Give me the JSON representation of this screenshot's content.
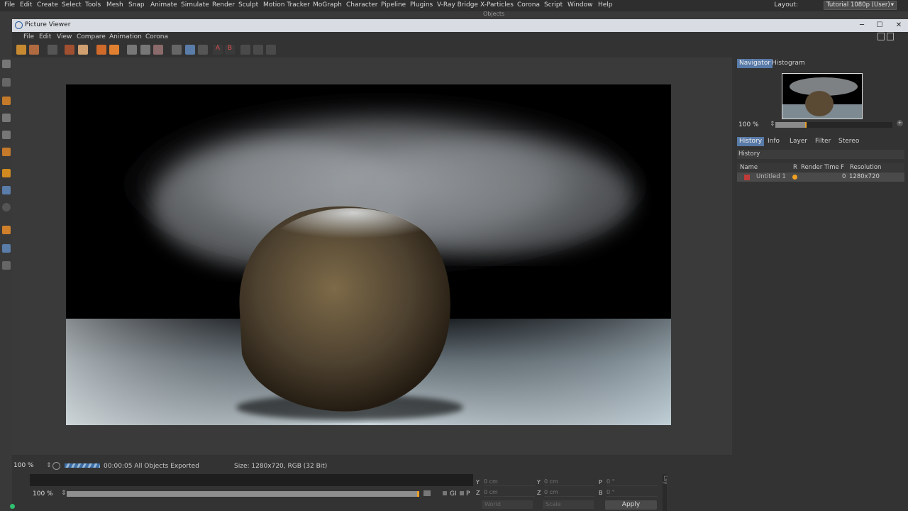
{
  "main_menu": [
    "File",
    "Edit",
    "Create",
    "Select",
    "Tools",
    "Mesh",
    "Snap",
    "Animate",
    "Simulate",
    "Render",
    "Sculpt",
    "Motion Tracker",
    "MoGraph",
    "Character",
    "Pipeline",
    "Plugins",
    "V-Ray Bridge",
    "X-Particles",
    "Corona",
    "Script",
    "Window",
    "Help"
  ],
  "layout": {
    "label": "Layout:",
    "value": "Tutorial 1080p (User)"
  },
  "background_tab_fragment": "Objects",
  "picture_viewer": {
    "title": "Picture Viewer",
    "menu": [
      "File",
      "Edit",
      "View",
      "Compare",
      "Animation",
      "Corona"
    ],
    "window_buttons": {
      "minimize": "─",
      "maximize": "☐",
      "close": "✕"
    }
  },
  "status_bar": {
    "zoom": "100 %",
    "progress_text": "00:00:05 All Objects Exported",
    "size_info": "Size: 1280x720, RGB (32 Bit)"
  },
  "right_panel": {
    "top_tabs": [
      "Navigator",
      "Histogram"
    ],
    "nav_zoom": "100 %",
    "bottom_tabs": [
      "History",
      "Info",
      "Layer",
      "Filter",
      "Stereo"
    ],
    "history_title": "History",
    "columns": {
      "name": "Name",
      "r": "R",
      "render_time": "Render Time",
      "f": "F",
      "resolution": "Resolution"
    },
    "rows": [
      {
        "name": "Untitled 1",
        "render_time": "",
        "f": "0",
        "resolution": "1280x720"
      }
    ]
  },
  "bottom": {
    "zoom": "100 %",
    "gi_label": "GI",
    "p_label": "P"
  },
  "coords": {
    "y1_label": "Y",
    "y1_val": "0 cm",
    "y2_label": "Y",
    "y2_val": "0 cm",
    "p_label": "P",
    "p_val": "0 °",
    "z1_label": "Z",
    "z1_val": "0 cm",
    "z2_label": "Z",
    "z2_val": "0 cm",
    "b_label": "B",
    "b_val": "0 °",
    "world": "World",
    "scale": "Scale",
    "apply": "Apply",
    "side_label": "Lay"
  },
  "colors": {
    "accent": "#587aa8",
    "highlight": "#e6a02a",
    "row_dot": "#f0a020"
  },
  "progress": 1.0
}
